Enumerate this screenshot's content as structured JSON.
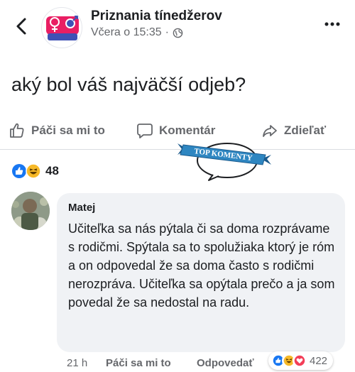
{
  "header": {
    "page_name": "Priznania tínedžerov",
    "timestamp": "Včera o 15:35",
    "separator": "·",
    "avatar_logo_text": "Priznania tínedžerov",
    "privacy_icon": "globe-icon",
    "more_icon": "more-dots-icon"
  },
  "post": {
    "text": "aký bol váš najväčší odjeb?"
  },
  "actions": {
    "like_label": "Páči sa mi to",
    "comment_label": "Komentár",
    "share_label": "Zdieľať"
  },
  "sticker": {
    "label": "TOP KOMENTY"
  },
  "reactions": {
    "count": "48",
    "icons": [
      "like-icon",
      "haha-icon"
    ]
  },
  "comment": {
    "author": "Matej",
    "text": "Učiteľka sa nás pýtala či sa doma rozprávame s rodičmi. Spýtala sa to spolužiaka ktorý je róm a on odpovedal že sa doma často s rodičmi nerozpráva. Učiteľka sa opýtala prečo a ja som povedal že sa nedostal na radu.",
    "time": "21 h",
    "like_label": "Páči sa mi to",
    "reply_label": "Odpovedať",
    "reaction_count": "422",
    "reaction_icons": [
      "like-icon",
      "haha-icon",
      "love-icon"
    ]
  },
  "colors": {
    "facebook_blue": "#1877f2",
    "love_red": "#f33e58",
    "haha_yellow": "#f7b928",
    "bubble_bg": "#f0f2f5",
    "secondary_text": "#65676b"
  }
}
